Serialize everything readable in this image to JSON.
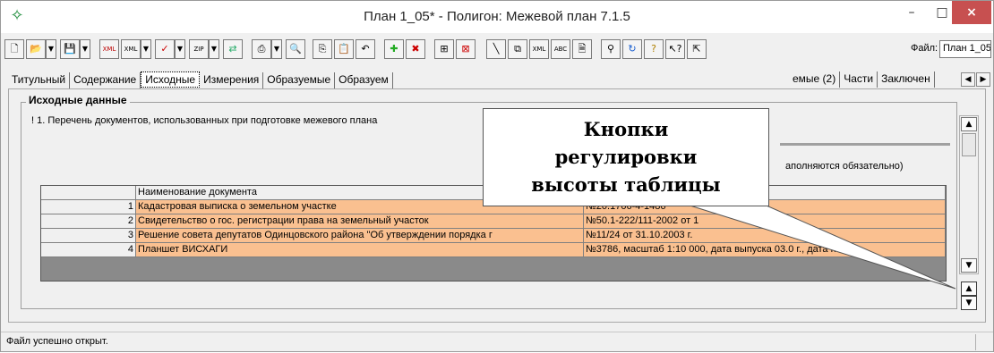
{
  "window": {
    "title": "План 1_05* - Полигон: Межевой план 7.1.5",
    "app_icon": "polygon-icon",
    "min_label": "–",
    "max_label": "□",
    "close_label": "×"
  },
  "toolbar": {
    "buttons": [
      "new-document-icon",
      "open-folder-icon",
      "save-icon",
      "xml-export-icon",
      "xml-import-icon",
      "check-icon",
      "zip-icon",
      "transfer-icon",
      "print-icon",
      "preview-icon",
      "copy-icon",
      "paste-icon",
      "undo-icon",
      "add-row-icon",
      "delete-row-icon",
      "insert-icon",
      "delete-icon",
      "line-icon",
      "copy-doc-icon",
      "xml-schema-icon",
      "abc-icon",
      "doc-icon",
      "search-icon",
      "refresh-icon",
      "help-icon",
      "context-help-icon",
      "cursor-icon"
    ],
    "file_label": "Файл:",
    "file_value": "План 1_05"
  },
  "tabs": [
    {
      "label": "Титульный",
      "active": false
    },
    {
      "label": "Содержание",
      "active": false
    },
    {
      "label": "Исходные",
      "active": true
    },
    {
      "label": "Измерения",
      "active": false
    },
    {
      "label": "Образуемые",
      "active": false
    },
    {
      "label": "Образуем",
      "active": false
    },
    {
      "label": "емые (2)",
      "active": false
    },
    {
      "label": "Части",
      "active": false
    },
    {
      "label": "Заключен",
      "active": false
    }
  ],
  "group": {
    "title": "Исходные данные",
    "paragraph": "! 1. Перечень документов, использованных при подготовке межевого плана",
    "note": "аполняются обязательно)"
  },
  "table": {
    "headers": [
      "",
      "Наименование документа",
      ""
    ],
    "rows": [
      {
        "num": "1",
        "name": "Кадастровая выписка о земельном участке",
        "details": "№20.1706-4-1486"
      },
      {
        "num": "2",
        "name": "Свидетельство о гос. регистрации права на земельный участок",
        "details": "№50.1-222/111-2002 от 1"
      },
      {
        "num": "3",
        "name": "Решение совета депутатов Одинцовского района \"Об утверждении порядка г",
        "details": "№11/24 от 31.10.2003 г."
      },
      {
        "num": "4",
        "name": "Планшет ВИСХАГИ",
        "details": "№3786, масштаб  1:10 000, дата выпуска 03.0 г., дата по"
      }
    ]
  },
  "callout": {
    "lines": [
      "Кнопки",
      "регулировки",
      "высоты таблицы"
    ]
  },
  "status": {
    "text": "Файл успешно открыт."
  }
}
